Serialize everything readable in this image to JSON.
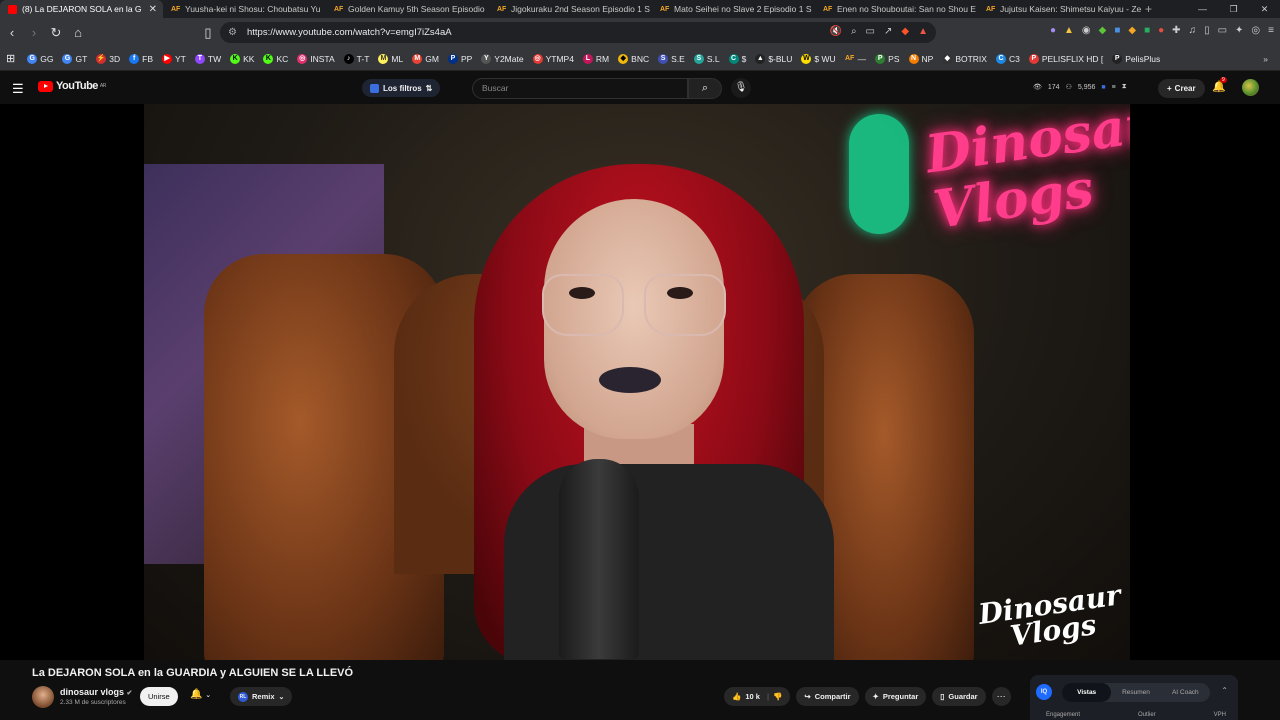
{
  "browser": {
    "tabs": [
      {
        "label": "(8) La DEJARON SOLA en la G",
        "fav": "youtube",
        "active": true
      },
      {
        "label": "Yuusha-kei ni Shosu: Choubatsu Yu",
        "fav": "AF"
      },
      {
        "label": "Golden Kamuy 5th Season Episodio",
        "fav": "AF"
      },
      {
        "label": "Jigokuraku 2nd Season Episodio 1 S",
        "fav": "AF"
      },
      {
        "label": "Mato Seihei no Slave 2 Episodio 1 S",
        "fav": "AF"
      },
      {
        "label": "Enen no Shouboutai: San no Shou E",
        "fav": "AF"
      },
      {
        "label": "Jujutsu Kaisen: Shimetsu Kaiyuu - Ze",
        "fav": "AF"
      }
    ],
    "url": "https://www.youtube.com/watch?v=emgI7iZs4aA",
    "bookmarks": [
      "GG",
      "GT",
      "3D",
      "FB",
      "YT",
      "TW",
      "KK",
      "KC",
      "INSTA",
      "T-T",
      "ML",
      "GM",
      "PP",
      "Y2Mate",
      "YTMP4",
      "RM",
      "BNC",
      "S.E",
      "S.L",
      "$",
      "$-BLU",
      "$ WU",
      "—",
      "PS",
      "NP",
      "BOTRIX",
      "C3",
      "PELISFLIX HD [",
      "PelisPlus"
    ]
  },
  "youtube": {
    "logo_text": "YouTube",
    "logo_country": "AR",
    "filters_label": "Los filtros",
    "search_placeholder": "Buscar",
    "stat_a": "174",
    "stat_b": "5,956",
    "create_label": "Crear",
    "notif_count": "9"
  },
  "video": {
    "watermark_line1": "Dinosaur",
    "watermark_line2": "Vlogs",
    "neon_line1": "Dinosaur",
    "neon_line2": "Vlogs",
    "title": "La DEJARON SOLA en la GUARDIA y ALGUIEN SE LA LLEVÓ"
  },
  "channel": {
    "name": "dinosaur vlogs",
    "subscribers": "2.33 M de suscriptores",
    "join_label": "Unirse",
    "remix_label": "Remix"
  },
  "actions": {
    "likes": "10 k",
    "share": "Compartir",
    "ask": "Preguntar",
    "save": "Guardar"
  },
  "panel": {
    "tabs": [
      "Vistas",
      "Resumen",
      "AI Coach"
    ],
    "sub": [
      "Engagement",
      "Outlier",
      "VPH"
    ]
  }
}
